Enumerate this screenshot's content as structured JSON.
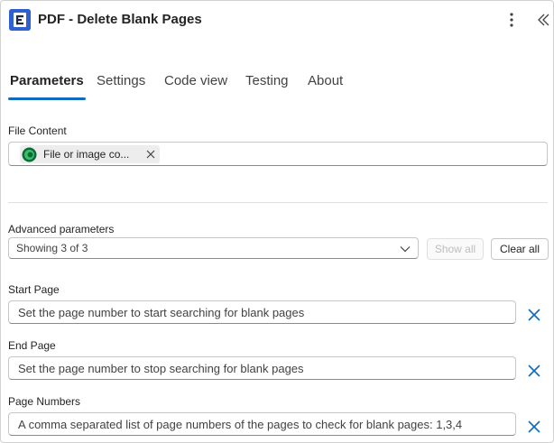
{
  "header": {
    "title": "PDF - Delete Blank Pages",
    "app_icon": "app-logo-icon",
    "more_icon": "more-vertical-icon",
    "collapse_icon": "collapse-chevrons-icon"
  },
  "tabs": [
    {
      "label": "Parameters",
      "active": true
    },
    {
      "label": "Settings",
      "active": false
    },
    {
      "label": "Code view",
      "active": false
    },
    {
      "label": "Testing",
      "active": false
    },
    {
      "label": "About",
      "active": false
    }
  ],
  "file_content": {
    "label": "File Content",
    "chip_label": "File or image co...",
    "chip_icon": "dataverse-icon"
  },
  "advanced": {
    "label": "Advanced parameters",
    "selected": "Showing 3 of 3",
    "show_all": "Show all",
    "clear_all": "Clear all"
  },
  "params": [
    {
      "label": "Start Page",
      "placeholder": "Set the page number to start searching for blank pages"
    },
    {
      "label": "End Page",
      "placeholder": "Set the page number to stop searching for blank pages"
    },
    {
      "label": "Page Numbers",
      "placeholder": "A comma separated list of page numbers of the pages to check for blank pages: 1,3,4"
    }
  ],
  "colors": {
    "accent": "#0f6cbd",
    "remove_icon": "#0f6cbd"
  }
}
